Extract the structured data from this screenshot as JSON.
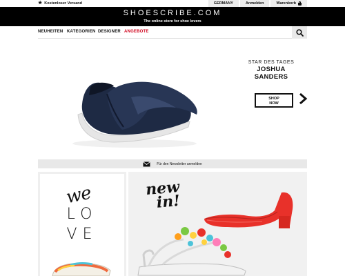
{
  "topbar": {
    "shipping_label": "Kostenloser Versand",
    "country": "GERMANY",
    "login": "Anmelden",
    "cart": "Warenkorb"
  },
  "header": {
    "logo": "SHOESCRIBE.COM",
    "tagline": "The online store for shoe lovers"
  },
  "nav": {
    "items": [
      "NEUHEITEN",
      "KATEGORIEN",
      "DESIGNER",
      "ANGEBOTE"
    ],
    "highlight_color": "#d0021b",
    "search_icon": "search-icon"
  },
  "hero": {
    "subtitle": "STAR DES TAGES",
    "designer": "JOSHUA SANDERS",
    "button_line1": "SHOP",
    "button_line2": "NOW",
    "next_icon": "chevron-right-icon"
  },
  "newsletter": {
    "label": "Für den Newsletter anmelden",
    "icon": "envelope-icon"
  },
  "tiles": {
    "left_line1": "we",
    "left_line2": "LO",
    "left_line3": "VE",
    "right_line1": "new",
    "right_line2": "in!"
  }
}
